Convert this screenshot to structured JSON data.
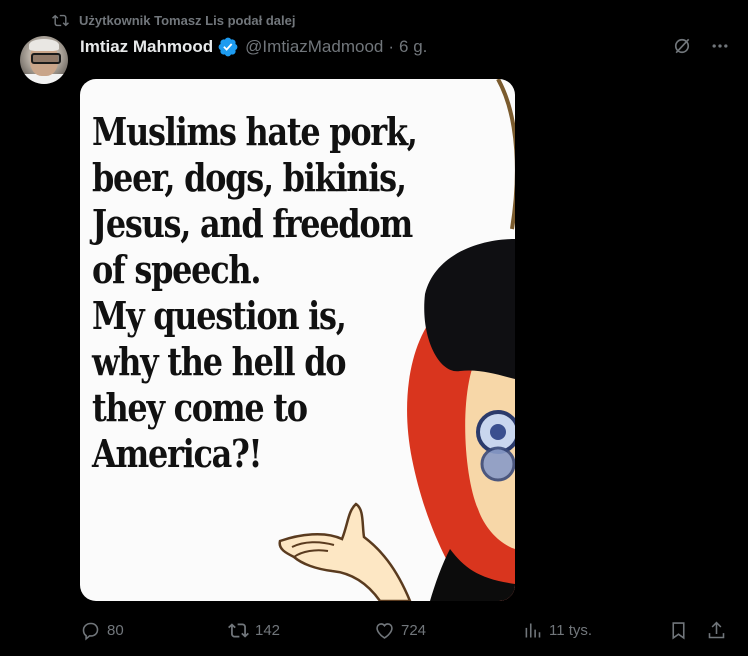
{
  "repost": {
    "text": "Użytkownik Tomasz Lis podał dalej"
  },
  "author": {
    "name": "Imtiaz Mahmood",
    "handle": "@ImtiazMadmood",
    "separator": "·",
    "time": "6 g."
  },
  "media": {
    "meme_lines": [
      "Muslims hate pork,",
      "beer, dogs, bikinis,",
      "Jesus, and freedom",
      "of speech.",
      "My question is,",
      "why the hell do",
      "they come to",
      "America?!"
    ]
  },
  "actions": {
    "replies": "80",
    "reposts": "142",
    "likes": "724",
    "views": "11 tys."
  },
  "colors": {
    "background": "#000000",
    "text": "#e7e9ea",
    "muted": "#71767b",
    "verified": "#1d9bf0"
  },
  "icons": {
    "repost": "repost-icon",
    "verified": "verified-badge-icon",
    "grok": "grok-icon",
    "more": "more-icon",
    "reply": "reply-icon",
    "like": "like-icon",
    "views": "views-icon",
    "bookmark": "bookmark-icon",
    "share": "share-icon"
  }
}
